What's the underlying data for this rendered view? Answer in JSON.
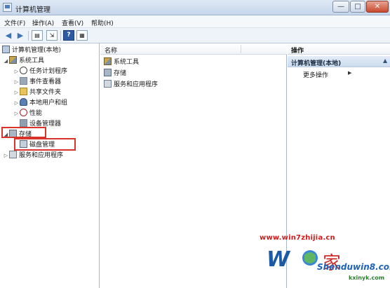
{
  "window": {
    "title": "计算机管理",
    "minimize": "—",
    "maximize": "□",
    "close": "✕"
  },
  "menu": [
    "文件(F)",
    "操作(A)",
    "查看(V)",
    "帮助(H)"
  ],
  "toolbar": {
    "back_icon": "back-arrow-icon",
    "forward_icon": "forward-arrow-icon",
    "show_tree_icon": "console-tree-icon",
    "export_icon": "export-list-icon",
    "help_icon": "help-icon",
    "help_label": "?",
    "properties_icon": "properties-icon"
  },
  "tree": {
    "root": "计算机管理(本地)",
    "items": [
      {
        "label": "系统工具",
        "level": 1,
        "expanded": true,
        "icon": "tools-icon"
      },
      {
        "label": "任务计划程序",
        "level": 2,
        "icon": "clock-icon"
      },
      {
        "label": "事件查看器",
        "level": 2,
        "icon": "event-viewer-icon"
      },
      {
        "label": "共享文件夹",
        "level": 2,
        "icon": "shared-folder-icon"
      },
      {
        "label": "本地用户和组",
        "level": 2,
        "icon": "users-icon"
      },
      {
        "label": "性能",
        "level": 2,
        "icon": "performance-icon"
      },
      {
        "label": "设备管理器",
        "level": 2,
        "icon": "device-manager-icon"
      },
      {
        "label": "存储",
        "level": 1,
        "expanded": true,
        "icon": "storage-icon"
      },
      {
        "label": "磁盘管理",
        "level": 2,
        "icon": "disk-icon"
      },
      {
        "label": "服务和应用程序",
        "level": 1,
        "expanded": false,
        "icon": "services-icon"
      }
    ]
  },
  "list": {
    "column_header": "名称",
    "items": [
      "系统工具",
      "存储",
      "服务和应用程序"
    ]
  },
  "actions": {
    "header": "操作",
    "section": "计算机管理(本地)",
    "more": "更多操作"
  },
  "watermark": {
    "url": "www.win7zhijia.cn",
    "brand": "Shenduwin8.com",
    "sub": "kxinyk.com"
  },
  "colors": {
    "highlight": "#d9342b",
    "accent": "#3c74b8"
  }
}
